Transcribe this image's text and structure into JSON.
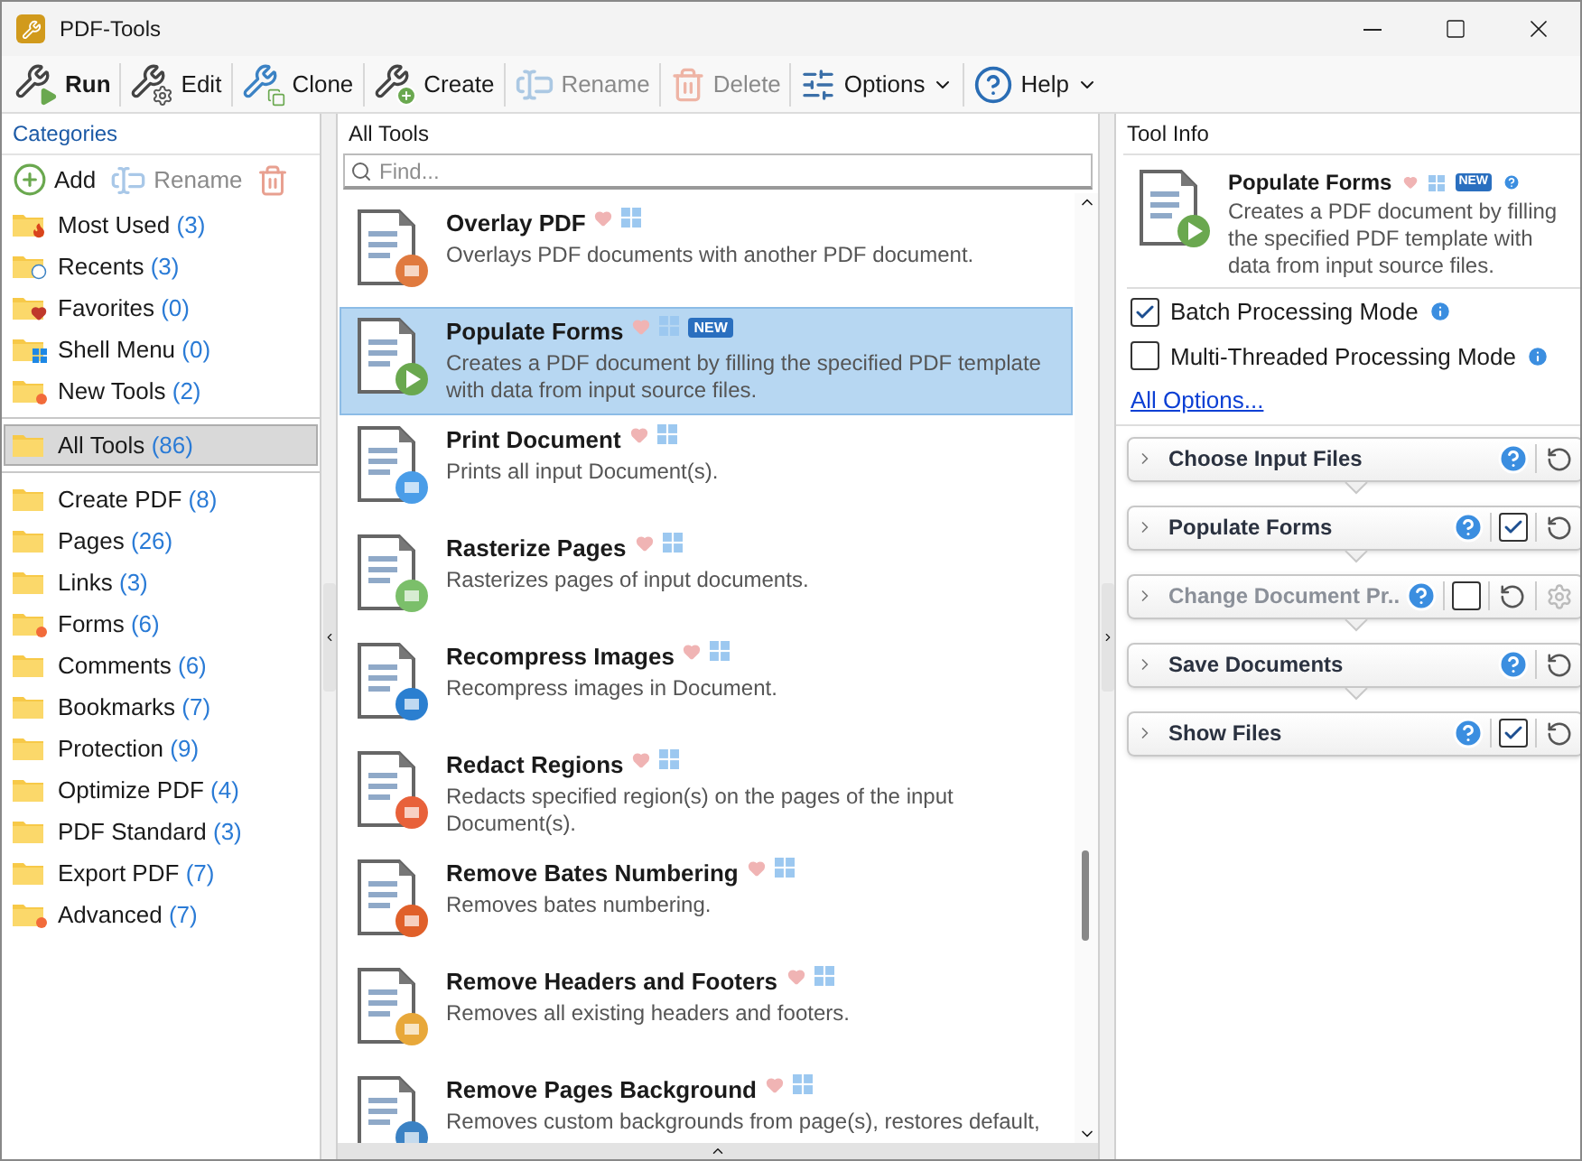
{
  "window": {
    "title": "PDF-Tools"
  },
  "toolbar": [
    {
      "label": "Run",
      "kind": "run",
      "disabled": false,
      "dropdown": false
    },
    {
      "label": "Edit",
      "kind": "edit",
      "disabled": false,
      "dropdown": false
    },
    {
      "label": "Clone",
      "kind": "clone",
      "disabled": false,
      "dropdown": false
    },
    {
      "label": "Create",
      "kind": "create",
      "disabled": false,
      "dropdown": false
    },
    {
      "label": "Rename",
      "kind": "rename",
      "disabled": true,
      "dropdown": false
    },
    {
      "label": "Delete",
      "kind": "delete",
      "disabled": true,
      "dropdown": false
    },
    {
      "label": "Options",
      "kind": "options",
      "disabled": false,
      "dropdown": true
    },
    {
      "label": "Help",
      "kind": "help",
      "disabled": false,
      "dropdown": true
    }
  ],
  "categories": {
    "title": "Categories",
    "actions": [
      {
        "label": "Add",
        "kind": "add",
        "disabled": false
      },
      {
        "label": "Rename",
        "kind": "rename",
        "disabled": true
      },
      {
        "kind": "delete",
        "disabled": true
      }
    ],
    "sections": [
      {
        "items": [
          {
            "name": "Most Used",
            "count": "(3)",
            "kind": "fire",
            "selected": false
          },
          {
            "name": "Recents",
            "count": "(3)",
            "kind": "clock",
            "selected": false
          },
          {
            "name": "Favorites",
            "count": "(0)",
            "kind": "heart",
            "selected": false
          },
          {
            "name": "Shell Menu",
            "count": "(0)",
            "kind": "windows",
            "selected": false
          },
          {
            "name": "New Tools",
            "count": "(2)",
            "kind": "dot",
            "selected": false
          }
        ]
      },
      {
        "items": [
          {
            "name": "All Tools",
            "count": "(86)",
            "kind": "none",
            "selected": true
          }
        ]
      },
      {
        "items": [
          {
            "name": "Create PDF",
            "count": "(8)",
            "kind": "none",
            "selected": false
          },
          {
            "name": "Pages",
            "count": "(26)",
            "kind": "none",
            "selected": false
          },
          {
            "name": "Links",
            "count": "(3)",
            "kind": "none",
            "selected": false
          },
          {
            "name": "Forms",
            "count": "(6)",
            "kind": "dot",
            "selected": false
          },
          {
            "name": "Comments",
            "count": "(6)",
            "kind": "none",
            "selected": false
          },
          {
            "name": "Bookmarks",
            "count": "(7)",
            "kind": "none",
            "selected": false
          },
          {
            "name": "Protection",
            "count": "(9)",
            "kind": "none",
            "selected": false
          },
          {
            "name": "Optimize PDF",
            "count": "(4)",
            "kind": "none",
            "selected": false
          },
          {
            "name": "PDF Standard",
            "count": "(3)",
            "kind": "none",
            "selected": false
          },
          {
            "name": "Export PDF",
            "count": "(7)",
            "kind": "none",
            "selected": false
          },
          {
            "name": "Advanced",
            "count": "(7)",
            "kind": "dot",
            "selected": false
          }
        ]
      }
    ]
  },
  "tools": {
    "title": "All Tools",
    "search": {
      "placeholder": "Find..."
    },
    "items": [
      {
        "name": "Overlay PDF",
        "description": "Overlays PDF documents with another PDF document.",
        "kind": "overlay",
        "new": false,
        "selected": false
      },
      {
        "name": "Populate Forms",
        "description": "Creates a PDF document by filling the specified PDF template with data from input source files.",
        "kind": "form",
        "new": true,
        "new_label": "NEW",
        "selected": true
      },
      {
        "name": "Print Document",
        "description": "Prints all input Document(s).",
        "kind": "print",
        "new": false,
        "selected": false
      },
      {
        "name": "Rasterize Pages",
        "description": "Rasterizes pages of input documents.",
        "kind": "raster",
        "new": false,
        "selected": false
      },
      {
        "name": "Recompress Images",
        "description": "Recompress images in Document.",
        "kind": "image",
        "new": false,
        "selected": false
      },
      {
        "name": "Redact Regions",
        "description": "Redacts specified region(s) on the pages of the input Document(s).",
        "kind": "redact",
        "new": false,
        "selected": false
      },
      {
        "name": "Remove Bates Numbering",
        "description": "Removes bates numbering.",
        "kind": "bates",
        "new": false,
        "selected": false
      },
      {
        "name": "Remove Headers and Footers",
        "description": "Removes all existing headers and footers.",
        "kind": "headers",
        "new": false,
        "selected": false
      },
      {
        "name": "Remove Pages Background",
        "description": "Removes custom backgrounds from page(s), restores default,",
        "kind": "background",
        "new": false,
        "selected": false
      }
    ]
  },
  "tool_info": {
    "title": "Tool Info",
    "tool": {
      "name": "Populate Forms",
      "description": "Creates a PDF document by filling the specified PDF template with data from input source files.",
      "new": true,
      "new_label": "NEW"
    },
    "options": [
      {
        "label": "Batch Processing Mode",
        "checked": true
      },
      {
        "label": "Multi-Threaded Processing Mode",
        "checked": false
      }
    ],
    "link": "All Options...",
    "steps": [
      {
        "name": "Choose Input Files",
        "disabled": false,
        "kind": "plain",
        "settings": false
      },
      {
        "name": "Populate Forms",
        "disabled": false,
        "kind": "toggle",
        "checked": true,
        "settings": false
      },
      {
        "name": "Change Document Pr..",
        "disabled": true,
        "kind": "toggle",
        "checked": false,
        "settings": true
      },
      {
        "name": "Save Documents",
        "disabled": false,
        "kind": "plain",
        "settings": false
      },
      {
        "name": "Show Files",
        "disabled": false,
        "kind": "toggle",
        "checked": true,
        "settings": false
      }
    ]
  }
}
